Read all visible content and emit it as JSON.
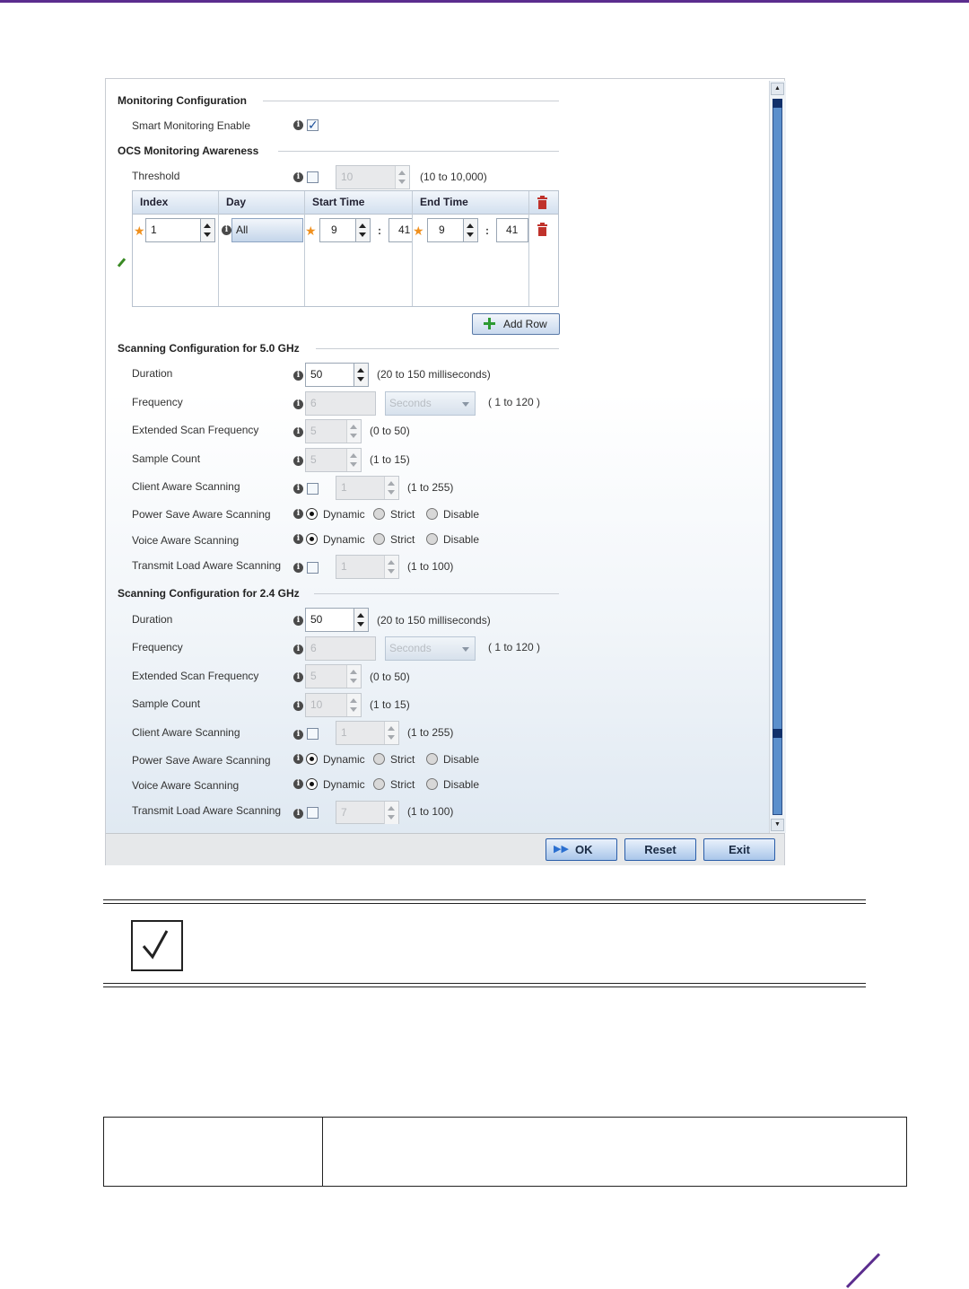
{
  "sections": {
    "monitoring": "Monitoring Configuration",
    "ocs": "OCS Monitoring Awareness",
    "scan5": "Scanning Configuration for 5.0 GHz",
    "scan24": "Scanning Configuration for 2.4 GHz"
  },
  "monitoring": {
    "smart_label": "Smart Monitoring Enable",
    "smart_checked": true
  },
  "ocs": {
    "threshold_label": "Threshold",
    "threshold_value": "10",
    "threshold_range": "(10 to 10,000)",
    "columns": [
      "Index",
      "Day",
      "Start Time",
      "End Time"
    ],
    "row": {
      "index": "1",
      "day": "All",
      "start_hour": "9",
      "start_min": "41",
      "end_hour": "9",
      "end_min": "41",
      "sep": ":"
    },
    "add_row": "Add Row"
  },
  "scan5": {
    "duration_label": "Duration",
    "duration_value": "50",
    "duration_range": "(20 to 150 milliseconds)",
    "frequency_label": "Frequency",
    "frequency_value": "6",
    "frequency_unit": "Seconds",
    "frequency_range": "( 1 to 120 )",
    "ext_label": "Extended Scan Frequency",
    "ext_value": "5",
    "ext_range": "(0 to 50)",
    "sample_label": "Sample Count",
    "sample_value": "5",
    "sample_range": "(1 to 15)",
    "client_label": "Client Aware Scanning",
    "client_value": "1",
    "client_range": "(1 to 255)",
    "power_label": "Power Save Aware Scanning",
    "voice_label": "Voice Aware Scanning",
    "opt_dynamic": "Dynamic",
    "opt_strict": "Strict",
    "opt_disable": "Disable",
    "transmit_label": "Transmit Load Aware Scanning",
    "transmit_value": "1",
    "transmit_range": "(1 to 100)"
  },
  "scan24": {
    "duration_label": "Duration",
    "duration_value": "50",
    "duration_range": "(20 to 150 milliseconds)",
    "frequency_label": "Frequency",
    "frequency_value": "6",
    "frequency_unit": "Seconds",
    "frequency_range": "( 1 to 120 )",
    "ext_label": "Extended Scan Frequency",
    "ext_value": "5",
    "ext_range": "(0 to 50)",
    "sample_label": "Sample Count",
    "sample_value": "10",
    "sample_range": "(1 to 15)",
    "client_label": "Client Aware Scanning",
    "client_value": "1",
    "client_range": "(1 to 255)",
    "power_label": "Power Save Aware Scanning",
    "voice_label": "Voice Aware Scanning",
    "opt_dynamic": "Dynamic",
    "opt_strict": "Strict",
    "opt_disable": "Disable",
    "transmit_label": "Transmit Load Aware Scanning",
    "transmit_value": "7",
    "transmit_range": "(1 to 100)"
  },
  "footer": {
    "ok": "OK",
    "reset": "Reset",
    "exit": "Exit"
  },
  "colors": {
    "accent": "#5b2d8e",
    "button_border": "#2a5da8",
    "required_star": "#f0901e",
    "delete_icon": "#c0322b",
    "add_icon": "#2d9a32"
  }
}
